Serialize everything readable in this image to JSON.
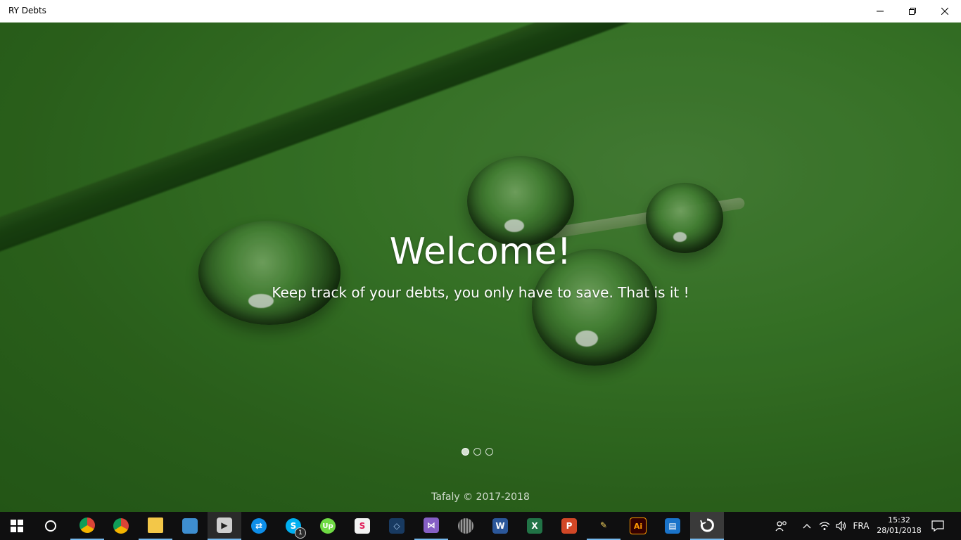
{
  "window": {
    "title": "RY Debts",
    "controls": {
      "minimize_icon": "minimize-icon",
      "restore_icon": "restore-icon",
      "close_icon": "close-icon"
    }
  },
  "hero": {
    "heading": "Welcome!",
    "subtitle": "Keep track of your debts, you only have to save. That is it !",
    "pager": {
      "count": 3,
      "active_index": 0
    },
    "footer": "Tafaly © 2017-2018",
    "background_color": "#3c7f2a"
  },
  "taskbar": {
    "apps": [
      {
        "name": "start-button",
        "icon": "windows-logo-icon",
        "running": false
      },
      {
        "name": "cortana-button",
        "icon": "cortana-circle-icon",
        "running": false
      },
      {
        "name": "chrome-profile-1",
        "icon": "chrome-icon",
        "running": true
      },
      {
        "name": "chrome-profile-2",
        "icon": "chrome-icon",
        "running": false
      },
      {
        "name": "file-explorer",
        "icon": "folder-icon",
        "running": true
      },
      {
        "name": "remote-desktop",
        "icon": "remote-desktop-icon",
        "running": false
      },
      {
        "name": "movie-maker",
        "icon": "clapperboard-icon",
        "running": true
      },
      {
        "name": "teamviewer",
        "icon": "teamviewer-icon",
        "running": false
      },
      {
        "name": "skype",
        "icon": "skype-icon",
        "running": false,
        "badge": "1"
      },
      {
        "name": "upwork",
        "icon": "upwork-icon",
        "running": false
      },
      {
        "name": "slack",
        "icon": "slack-icon",
        "running": false
      },
      {
        "name": "virtualbox",
        "icon": "virtualbox-icon",
        "running": false
      },
      {
        "name": "visual-studio",
        "icon": "visual-studio-icon",
        "running": true
      },
      {
        "name": "wireframe-app",
        "icon": "globe-icon",
        "running": false
      },
      {
        "name": "word",
        "icon": "word-icon",
        "running": false
      },
      {
        "name": "excel",
        "icon": "excel-icon",
        "running": false
      },
      {
        "name": "powerpoint",
        "icon": "powerpoint-icon",
        "running": false
      },
      {
        "name": "paint",
        "icon": "brush-icon",
        "running": true
      },
      {
        "name": "illustrator",
        "icon": "illustrator-icon",
        "running": false
      },
      {
        "name": "app-store-like",
        "icon": "store-icon",
        "running": false
      },
      {
        "name": "ry-debts",
        "icon": "ry-debts-icon",
        "running": true,
        "active": true
      }
    ],
    "tray": {
      "people_icon": "people-icon",
      "chevron_icon": "chevron-up-icon",
      "wifi_icon": "wifi-icon",
      "volume_icon": "volume-icon",
      "language": "FRA",
      "time": "15:32",
      "date": "28/01/2018",
      "notification_icon": "action-center-icon"
    }
  }
}
